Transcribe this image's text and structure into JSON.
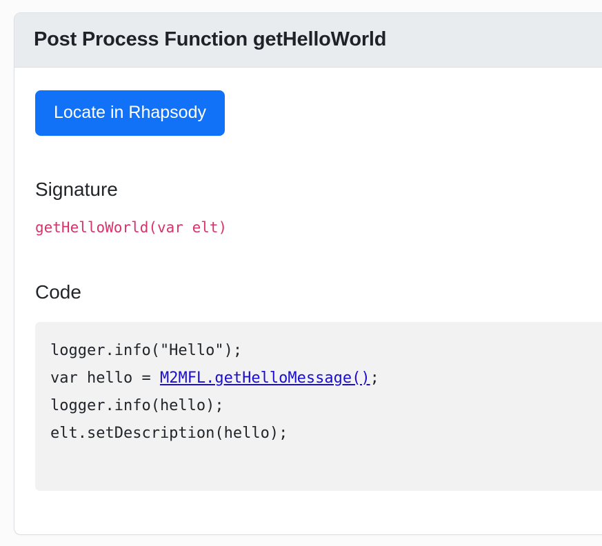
{
  "card": {
    "title": "Post Process Function getHelloWorld",
    "actions": {
      "locate_button": "Locate in Rhapsody"
    },
    "sections": {
      "signature": {
        "heading": "Signature",
        "value": "getHelloWorld(var elt)"
      },
      "code": {
        "heading": "Code",
        "lines": [
          {
            "before": "logger.info(\"Hello\");",
            "link": "",
            "after": ""
          },
          {
            "before": "var hello = ",
            "link": "M2MFL.getHelloMessage()",
            "after": ";"
          },
          {
            "before": "logger.info(hello);",
            "link": "",
            "after": ""
          },
          {
            "before": "elt.setDescription(hello);",
            "link": "",
            "after": ""
          }
        ]
      }
    }
  },
  "colors": {
    "page_background": "#fbfbfb",
    "card_background": "#ffffff",
    "card_header_background": "#e9ecef",
    "card_border": "#dcdfe3",
    "primary_button": "#1272f7",
    "primary_button_text": "#ffffff",
    "heading_text": "#212529",
    "signature_code": "#d6336c",
    "code_block_background": "#f2f2f2",
    "code_text": "#212529",
    "code_link": "#1a0dcd"
  }
}
